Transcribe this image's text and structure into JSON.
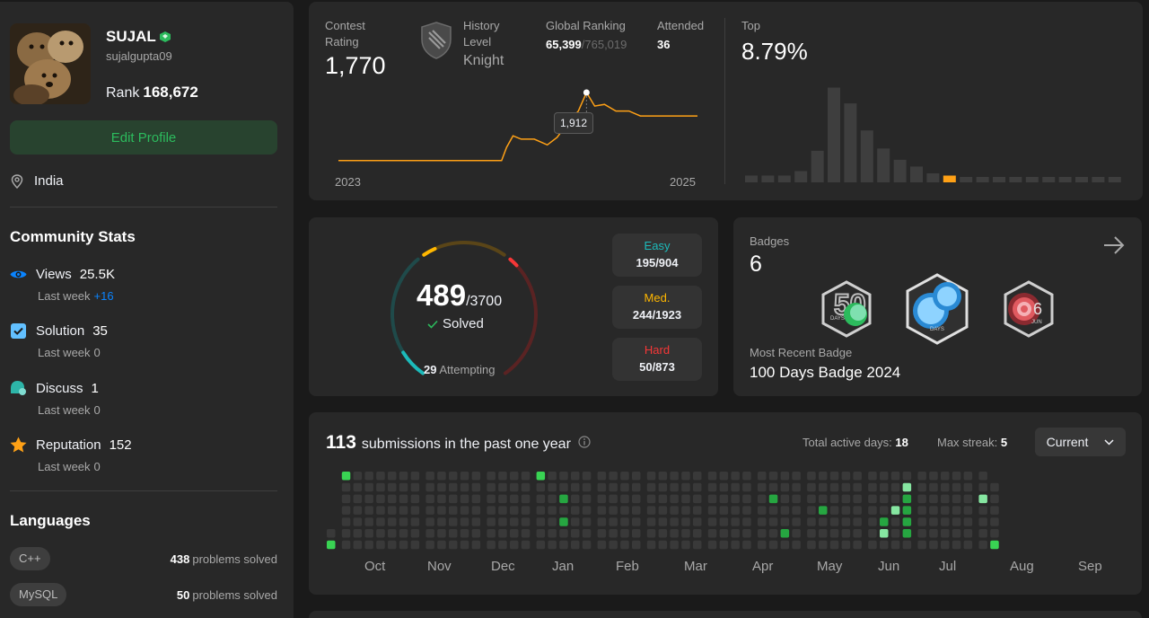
{
  "profile": {
    "name": "SUJAL",
    "handle": "sujalgupta09",
    "rank_label": "Rank",
    "rank_value": "168,672",
    "edit_label": "Edit Profile",
    "location": "India"
  },
  "community": {
    "title": "Community Stats",
    "items": [
      {
        "label": "Views",
        "value": "25.5K",
        "week_label": "Last week",
        "week_value": "+16",
        "icon": "eye-icon",
        "color": "#0a84ff"
      },
      {
        "label": "Solution",
        "value": "35",
        "week_label": "Last week",
        "week_value": "0",
        "icon": "checkbox-icon",
        "color": "#62c0ff"
      },
      {
        "label": "Discuss",
        "value": "1",
        "week_label": "Last week",
        "week_value": "0",
        "icon": "discuss-icon",
        "color": "#2db5a8"
      },
      {
        "label": "Reputation",
        "value": "152",
        "week_label": "Last week",
        "week_value": "0",
        "icon": "star-icon",
        "color": "#ffa116"
      }
    ]
  },
  "languages": {
    "title": "Languages",
    "items": [
      {
        "name": "C++",
        "count": "438",
        "suffix": "problems solved"
      },
      {
        "name": "MySQL",
        "count": "50",
        "suffix": "problems solved"
      }
    ]
  },
  "contest": {
    "rating_label": "Contest\nRating",
    "rating_l1": "Contest",
    "rating_l2": "Rating",
    "rating": "1,770",
    "level_l1": "History",
    "level_l2": "Level",
    "level": "Knight",
    "global_label": "Global Ranking",
    "global_rank": "65,399",
    "global_total": "/765,019",
    "attended_label": "Attended",
    "attended": "36",
    "top_label": "Top",
    "top_value": "8.79%",
    "year_start": "2023",
    "year_end": "2025",
    "tooltip": "1,912"
  },
  "chart_data": [
    {
      "type": "line",
      "title": "",
      "xlabel": "",
      "ylabel": "",
      "x": [
        2023.0,
        2023.3,
        2023.6,
        2023.9,
        2024.0,
        2024.03,
        2024.07,
        2024.12,
        2024.2,
        2024.28,
        2024.34,
        2024.4,
        2024.47,
        2024.52,
        2024.57,
        2024.63,
        2024.7,
        2024.78,
        2024.85,
        2025.0,
        2025.2
      ],
      "values": [
        1500,
        1500,
        1500,
        1500,
        1500,
        1580,
        1650,
        1630,
        1630,
        1595,
        1640,
        1720,
        1800,
        1912,
        1830,
        1840,
        1800,
        1800,
        1770,
        1770,
        1770
      ],
      "xlim": [
        2023,
        2025.2
      ],
      "ylim": [
        1450,
        1950
      ],
      "highlight_index": 13,
      "color": "#ffa116"
    },
    {
      "type": "bar",
      "title": "",
      "xlabel": "",
      "ylabel": "",
      "values": [
        3,
        3,
        3,
        5,
        14,
        42,
        35,
        23,
        15,
        10,
        7,
        4,
        3,
        2,
        2,
        2,
        2,
        2,
        2,
        2,
        2,
        2,
        2
      ],
      "highlight_index": 12,
      "highlight_color": "#ffa116",
      "bar_color": "#3e3e3e",
      "ylim": [
        0,
        45
      ]
    },
    {
      "type": "heatmap",
      "title": "",
      "months": [
        "Oct",
        "Nov",
        "Dec",
        "Jan",
        "Feb",
        "Mar",
        "Apr",
        "May",
        "Jun",
        "Jul",
        "Aug",
        "Sep"
      ],
      "levels": [
        "none",
        "low",
        "mid",
        "high"
      ],
      "colors": [
        "#393939",
        "#0e4429",
        "#006d32",
        "#26a641",
        "#39d353",
        "#86e6a1"
      ],
      "active_cells": [
        {
          "week": 0,
          "day": 6,
          "level": 4
        },
        {
          "week": 1,
          "day": 0,
          "level": 4
        },
        {
          "week": 17,
          "day": 0,
          "level": 4
        },
        {
          "week": 19,
          "day": 2,
          "level": 3
        },
        {
          "week": 19,
          "day": 4,
          "level": 3
        },
        {
          "week": 36,
          "day": 2,
          "level": 3
        },
        {
          "week": 37,
          "day": 5,
          "level": 3
        },
        {
          "week": 40,
          "day": 3,
          "level": 3
        },
        {
          "week": 45,
          "day": 4,
          "level": 3
        },
        {
          "week": 45,
          "day": 5,
          "level": 5
        },
        {
          "week": 46,
          "day": 3,
          "level": 5
        },
        {
          "week": 47,
          "day": 1,
          "level": 5
        },
        {
          "week": 47,
          "day": 2,
          "level": 3
        },
        {
          "week": 47,
          "day": 3,
          "level": 3
        },
        {
          "week": 47,
          "day": 4,
          "level": 3
        },
        {
          "week": 47,
          "day": 5,
          "level": 3
        },
        {
          "week": 53,
          "day": 2,
          "level": 5
        },
        {
          "week": 54,
          "day": 6,
          "level": 4
        }
      ]
    }
  ],
  "solved": {
    "count": "489",
    "total": "/3700",
    "solved_label": "Solved",
    "attempting_count": "29",
    "attempting_label": "Attempting",
    "difficulties": [
      {
        "label": "Easy",
        "value": "195/904",
        "color": "#1cbaba"
      },
      {
        "label": "Med.",
        "value": "244/1923",
        "color": "#ffb700"
      },
      {
        "label": "Hard",
        "value": "50/873",
        "color": "#f63737"
      }
    ]
  },
  "badges": {
    "title": "Badges",
    "count": "6",
    "recent_label": "Most Recent Badge",
    "recent_name": "100 Days Badge 2024",
    "items": [
      {
        "name": "50-days-badge-icon",
        "num": "50",
        "sub": "DAYS"
      },
      {
        "name": "100-days-badge-icon",
        "num": "",
        "sub": "DAYS"
      },
      {
        "name": "june-badge-icon",
        "num": "6",
        "sub": "JUN"
      }
    ]
  },
  "submissions": {
    "count": "113",
    "label": "submissions in the past one year",
    "active_label": "Total active days:",
    "active_value": "18",
    "streak_label": "Max streak:",
    "streak_value": "5",
    "select_value": "Current"
  }
}
